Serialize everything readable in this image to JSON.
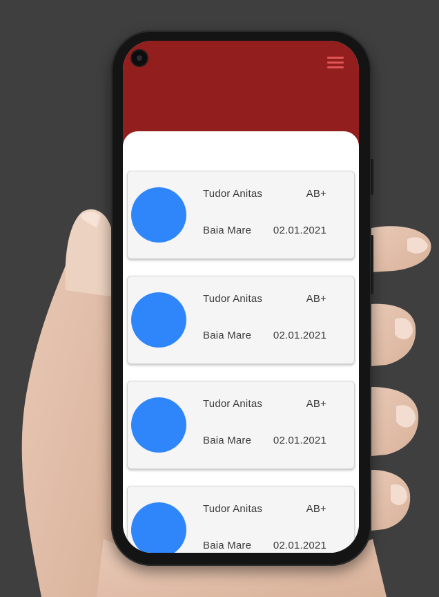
{
  "colors": {
    "header": "#921e1e",
    "menu_icon": "#e25555",
    "avatar": "#2f86fb",
    "card_bg": "#f5f5f5",
    "background": "#3f3f3f"
  },
  "header": {
    "menu_icon": "hamburger-menu-icon"
  },
  "donors": [
    {
      "name": "Tudor Anitas",
      "blood_type": "AB+",
      "city": "Baia Mare",
      "date": "02.01.2021"
    },
    {
      "name": "Tudor Anitas",
      "blood_type": "AB+",
      "city": "Baia Mare",
      "date": "02.01.2021"
    },
    {
      "name": "Tudor Anitas",
      "blood_type": "AB+",
      "city": "Baia Mare",
      "date": "02.01.2021"
    },
    {
      "name": "Tudor Anitas",
      "blood_type": "AB+",
      "city": "Baia Mare",
      "date": "02.01.2021"
    }
  ]
}
